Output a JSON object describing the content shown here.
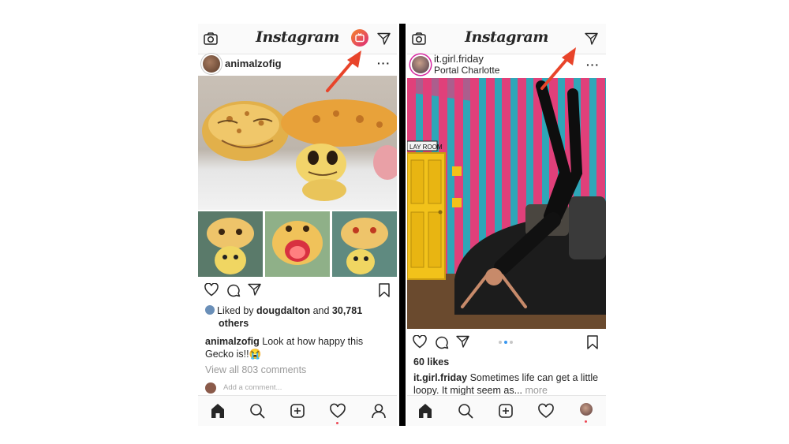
{
  "left": {
    "app_title": "Instagram",
    "post": {
      "username": "animalzofig",
      "liked_prefix": "Liked by",
      "liked_user": "dougdalton",
      "liked_and": "and",
      "liked_count": "30,781",
      "liked_others": "others",
      "caption_user": "animalzofig",
      "caption_text": "Look at how happy this Gecko is!!",
      "caption_emoji": "😭",
      "view_comments": "View all 803 comments",
      "comment_placeholder": "Add a comment..."
    }
  },
  "right": {
    "app_title": "Instagram",
    "post": {
      "username": "it.girl.friday",
      "location": "Portal Charlotte",
      "likes": "60 likes",
      "caption_user": "it.girl.friday",
      "caption_text": "Sometimes life can get a little loopy. It might seem as...",
      "caption_more": "more",
      "sign_text": "LAY ROOM"
    }
  },
  "colors": {
    "arrow": "#e8442a",
    "igtv_start": "#f58529",
    "igtv_end": "#dd2a7b",
    "notification": "#ed4956"
  },
  "icons": [
    "camera-icon",
    "igtv-icon",
    "direct-icon",
    "more-icon",
    "heart-icon",
    "comment-icon",
    "share-icon",
    "bookmark-icon",
    "home-icon",
    "search-icon",
    "add-icon",
    "activity-icon",
    "profile-icon"
  ]
}
